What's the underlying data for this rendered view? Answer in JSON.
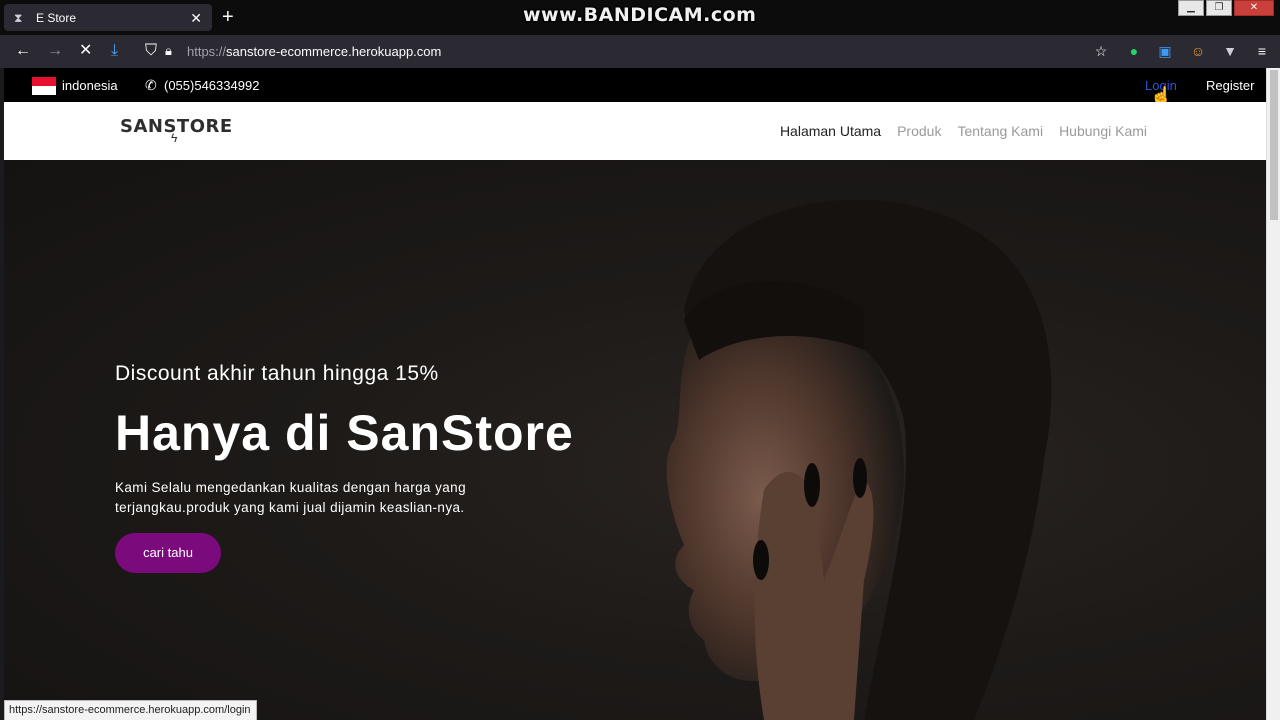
{
  "browser": {
    "tab_title": "E Store",
    "tab_favicon": "hourglass-icon",
    "url_scheme": "https://",
    "url_host": "sanstore-ecommerce.herokuapp.com",
    "watermark": "www.BANDICAM.com",
    "status_url": "https://sanstore-ecommerce.herokuapp.com/login"
  },
  "topbar": {
    "country": "indonesia",
    "phone": "(055)546334992",
    "login": "Login",
    "register": "Register"
  },
  "header": {
    "logo": "SANSTORE",
    "menu": [
      {
        "label": "Halaman Utama"
      },
      {
        "label": "Produk"
      },
      {
        "label": "Tentang Kami"
      },
      {
        "label": "Hubungi Kami"
      }
    ]
  },
  "hero": {
    "subtitle": "Discount akhir tahun hingga 15%",
    "title": "Hanya di SanStore",
    "description": "Kami Selalu mengedankan kualitas dengan harga yang terjangkau.produk yang kami jual dijamin keaslian-nya.",
    "button": "cari tahu"
  },
  "colors": {
    "accent": "#7b0a7d",
    "login_link": "#2c54d9"
  }
}
